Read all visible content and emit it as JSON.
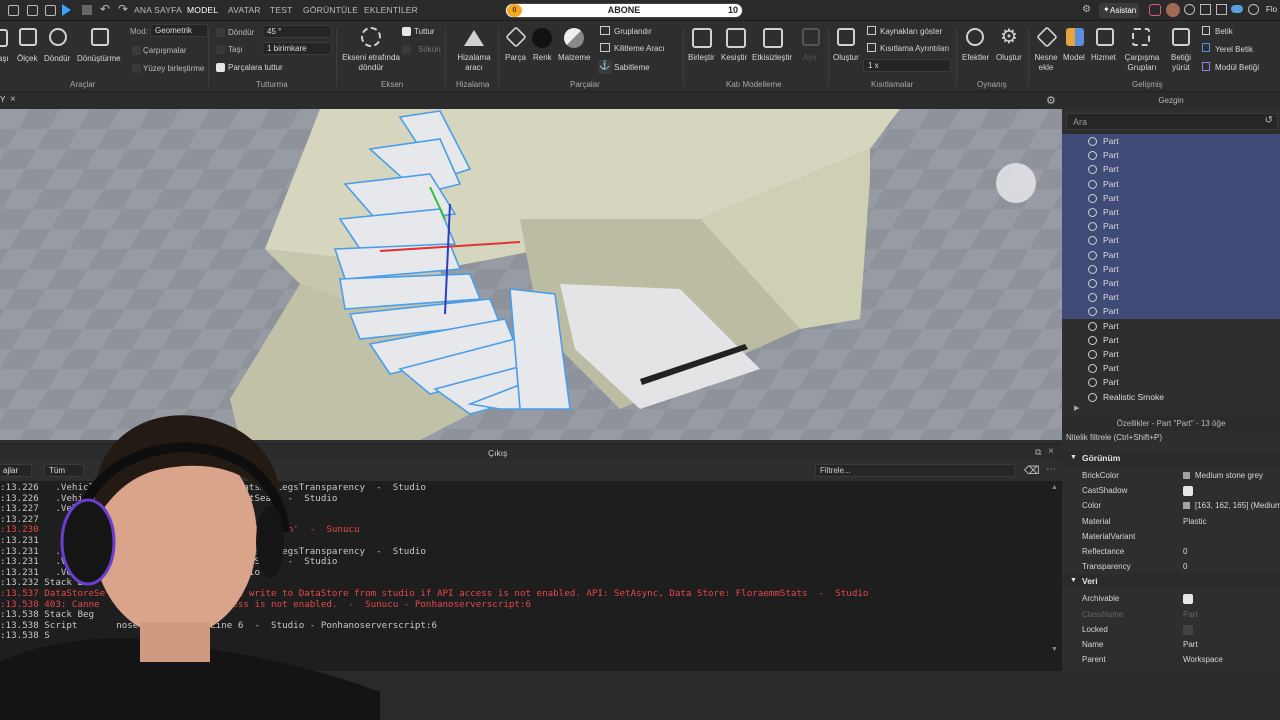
{
  "topbar": {
    "tabs": [
      "ANA SAYFA",
      "MODEL",
      "AVATAR",
      "TEST",
      "GÖRÜNTÜLE",
      "EKLENTİLER"
    ],
    "active_tab": "MODEL",
    "abone_label": "ABONE",
    "abone_count": "10",
    "abone_coin": "0",
    "assistant": "Asistan",
    "user": "Flo"
  },
  "ribbon": {
    "tools": {
      "labels": [
        "aşı",
        "Ölçek",
        "Döndür",
        "Dönüştürme"
      ],
      "group": "Araçlar",
      "mode_label": "Mod:",
      "mode_value": "Geometrik",
      "collisions": "Çarpışmalar",
      "surface_join": "Yüzey birleştirme"
    },
    "snap": {
      "rotate_label": "Döndür",
      "rotate_value": "45 °",
      "move_label": "Taşı",
      "move_value": "1 birimkare",
      "parts_hold": "Parçalara tuttur",
      "group": "Tutturma"
    },
    "axis": {
      "attach": "Tuttur",
      "detach": "Sökün",
      "rotate_axis": "Ekseni etrafında döndür",
      "group": "Eksen"
    },
    "align": {
      "tool": "Hizalama aracı",
      "group": "Hizalama"
    },
    "parts": {
      "part": "Parça",
      "color": "Renk",
      "material": "Malzeme",
      "group_btn": "Gruplandır",
      "lock_tool": "Kilitleme Aracı",
      "anchor": "Sabitleme",
      "group": "Parçalar"
    },
    "solid": {
      "union": "Birleştir",
      "intersect": "Kesiştir",
      "negate": "Etkisizleştir",
      "separate": "Ayır",
      "group": "Katı Modelleme"
    },
    "constraints": {
      "create": "Oluştur",
      "show_sources": "Kaynakları göster",
      "constraint_details": "Kısıtlama Ayrıntıları",
      "scale": "1 x",
      "group": "Kısıtlamalar"
    },
    "gameplay": {
      "effects": "Efektler",
      "create": "Oluştur",
      "group": "Oynanış"
    },
    "advanced": {
      "mesh_add": "Nesne ekle",
      "model": "Model",
      "service": "Hizmet",
      "collision_groups": "Çarpışma Grupları",
      "run_script": "Betiği yürüt",
      "script": "Betik",
      "local_script": "Yerel Betik",
      "module_script": "Modül Betiği",
      "group": "Gelişmiş"
    }
  },
  "doc": {
    "tab_label": "Y",
    "close": "×"
  },
  "output": {
    "title": "Çıkış",
    "filter_placeholder": "Filtrele...",
    "left_controls": [
      "ajlar",
      "Tüm"
    ],
    "lines": [
      {
        "t": ":13.226",
        "m": "   .Vehicle', Line 48 - function setHatsAndLegsTransparency  -  Studio",
        "err": false
      },
      {
        "t": ":13.226",
        "m": "   .Vehicle', Line 87 - function onExitSeat  -  Studio",
        "err": false
      },
      {
        "t": ":13.227",
        "m": "   .Vehicle', Line 131  -  Studio",
        "err": false
      },
      {
        "t": ":13.227",
        "m": "",
        "err": false
      },
      {
        "t": ":13.230",
        "m": "     0: attempt to index nil with 'GetChildren'  -  Sunucu",
        "err": true
      },
      {
        "t": ":13.231",
        "m": "",
        "err": false
      },
      {
        "t": ":13.231",
        "m": "   .Vehicle', Line 48 - function setHatsAndLegsTransparency  -  Studio",
        "err": false
      },
      {
        "t": ":13.231",
        "m": "   .Vehicle', Line 87 - function onExitSeat  -  Studio",
        "err": false
      },
      {
        "t": ":13.231",
        "m": "   .VehicleSeating', Line 297  -  Studio",
        "err": false
      },
      {
        "t": ":13.232",
        "m": " Stack End",
        "err": false
      },
      {
        "t": ":13.537",
        "m": " DataStoreSe       NotAllowed: Cannot write to DataStore from studio if API access is not enabled. API: SetAsync, Data Store: FloraemmStats  -  Studio",
        "err": true
      },
      {
        "t": ":13.538",
        "m": " 403: Canne       studio if API access is not enabled.  -  Sunucu - Ponhanoserverscript:6",
        "err": true
      },
      {
        "t": ":13.538",
        "m": " Stack Beg",
        "err": false
      },
      {
        "t": ":13.538",
        "m": " Script       noserverscript', Line 6  -  Studio - Ponhanoserverscript:6",
        "err": false
      },
      {
        "t": ":13.538",
        "m": " S",
        "err": false
      }
    ]
  },
  "explorer": {
    "title": "Gezgin",
    "search_placeholder": "Ara",
    "items": [
      {
        "label": "Part",
        "sel": true
      },
      {
        "label": "Part",
        "sel": true
      },
      {
        "label": "Part",
        "sel": true
      },
      {
        "label": "Part",
        "sel": true
      },
      {
        "label": "Part",
        "sel": true
      },
      {
        "label": "Part",
        "sel": true
      },
      {
        "label": "Part",
        "sel": true
      },
      {
        "label": "Part",
        "sel": true
      },
      {
        "label": "Part",
        "sel": true
      },
      {
        "label": "Part",
        "sel": true
      },
      {
        "label": "Part",
        "sel": true
      },
      {
        "label": "Part",
        "sel": true
      },
      {
        "label": "Part",
        "sel": true
      },
      {
        "label": "Part",
        "sel": false
      },
      {
        "label": "Part",
        "sel": false
      },
      {
        "label": "Part",
        "sel": false
      },
      {
        "label": "Part",
        "sel": false
      },
      {
        "label": "Part",
        "sel": false
      },
      {
        "label": "Realistic Smoke",
        "sel": false
      }
    ]
  },
  "properties": {
    "title": "Özellikler - Part \"Part\" - 13 öğe",
    "filter": "Nitelik filtrele (Ctrl+Shift+P)",
    "sections": [
      {
        "name": "Görünüm",
        "rows": [
          {
            "k": "BrickColor",
            "v": "Medium stone grey",
            "kind": "swatch"
          },
          {
            "k": "CastShadow",
            "v": "",
            "kind": "check"
          },
          {
            "k": "Color",
            "v": "[163, 162, 165] (Medium",
            "kind": "swatch"
          },
          {
            "k": "Material",
            "v": "Plastic",
            "kind": "text"
          },
          {
            "k": "MaterialVariant",
            "v": "",
            "kind": "text"
          },
          {
            "k": "Reflectance",
            "v": "0",
            "kind": "text"
          },
          {
            "k": "Transparency",
            "v": "0",
            "kind": "text"
          }
        ]
      },
      {
        "name": "Veri",
        "rows": [
          {
            "k": "Archivable",
            "v": "",
            "kind": "check"
          },
          {
            "k": "ClassName",
            "v": "Part",
            "kind": "dim"
          },
          {
            "k": "Locked",
            "v": "",
            "kind": "checkoff"
          },
          {
            "k": "Name",
            "v": "Part",
            "kind": "text"
          },
          {
            "k": "Parent",
            "v": "Workspace",
            "kind": "text"
          }
        ]
      }
    ]
  },
  "colors": {
    "selection": "#3f4a77",
    "error": "#e5484d",
    "accent": "#5aa0ff"
  }
}
